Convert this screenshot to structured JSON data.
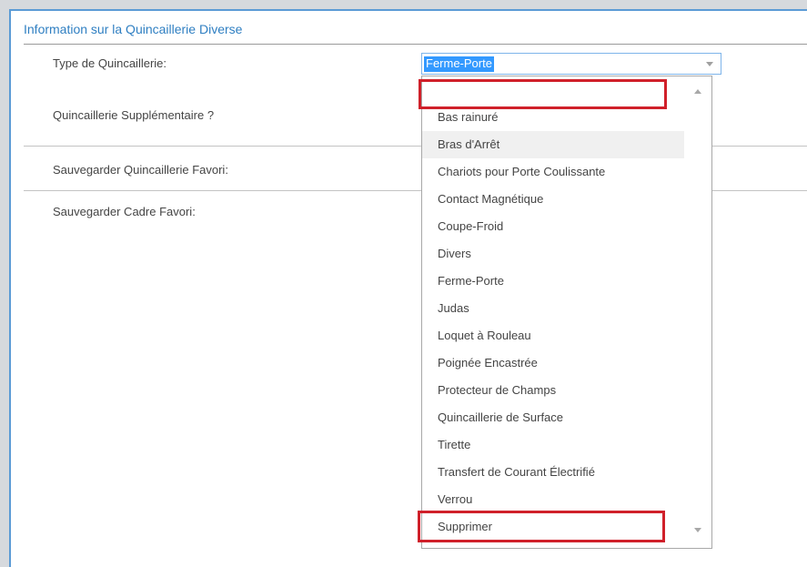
{
  "panel": {
    "title": "Information sur la Quincaillerie Diverse"
  },
  "form": {
    "type_label": "Type de Quincaillerie:",
    "supplementaire_label": "Quincaillerie Supplémentaire ?",
    "sauvegarder_quincaillerie_label": "Sauvegarder Quincaillerie Favori:",
    "sauvegarder_cadre_label": "Sauvegarder Cadre Favori:"
  },
  "select": {
    "value": "Ferme-Porte",
    "options": [
      "",
      "Bas rainuré",
      "Bras d'Arrêt",
      "Chariots pour Porte Coulissante",
      "Contact Magnétique",
      "Coupe-Froid",
      "Divers",
      "Ferme-Porte",
      "Judas",
      "Loquet à Rouleau",
      "Poignée Encastrée",
      "Protecteur de Champs",
      "Quincaillerie de Surface",
      "Tirette",
      "Transfert de Courant Électrifié",
      "Verrou",
      "Supprimer"
    ],
    "hovered_option": "Bras d'Arrêt"
  },
  "annotation_color": "#d0202a",
  "accent_color": "#2f7fc2"
}
